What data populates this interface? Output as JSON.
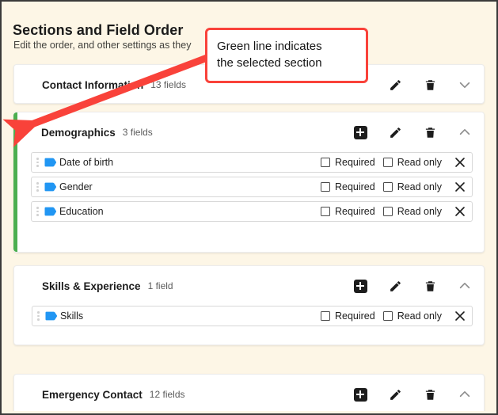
{
  "header": {
    "title": "Sections and Field Order",
    "subtitle": "Edit the order, and other settings as they"
  },
  "annotation": {
    "text_line1": "Green line indicates",
    "text_line2": "the selected section",
    "color": "#f9423a",
    "arrow": "callout-arrow"
  },
  "colors": {
    "page_background": "#fdf6e6",
    "card_background": "#ffffff",
    "selected_line": "#4caf50",
    "field_icon": "#2196f3",
    "annotation": "#f9423a"
  },
  "labels": {
    "required": "Required",
    "read_only": "Read only"
  },
  "sections": [
    {
      "name": "Contact Information",
      "count": "13 fields",
      "selected": false,
      "expanded": false,
      "has_add": false,
      "chevron": "chevron-down-icon",
      "fields": []
    },
    {
      "name": "Demographics",
      "count": "3 fields",
      "selected": true,
      "expanded": true,
      "has_add": true,
      "chevron": "chevron-up-icon",
      "fields": [
        {
          "name": "Date of birth",
          "required": false,
          "read_only": false
        },
        {
          "name": "Gender",
          "required": false,
          "read_only": false
        },
        {
          "name": "Education",
          "required": false,
          "read_only": false
        }
      ]
    },
    {
      "name": "Skills & Experience",
      "count": "1 field",
      "selected": false,
      "expanded": true,
      "has_add": true,
      "chevron": "chevron-up-icon",
      "fields": [
        {
          "name": "Skills",
          "required": false,
          "read_only": false
        }
      ]
    },
    {
      "name": "Emergency Contact",
      "count": "12 fields",
      "selected": false,
      "expanded": true,
      "has_add": true,
      "chevron": "chevron-up-icon",
      "fields": []
    }
  ]
}
